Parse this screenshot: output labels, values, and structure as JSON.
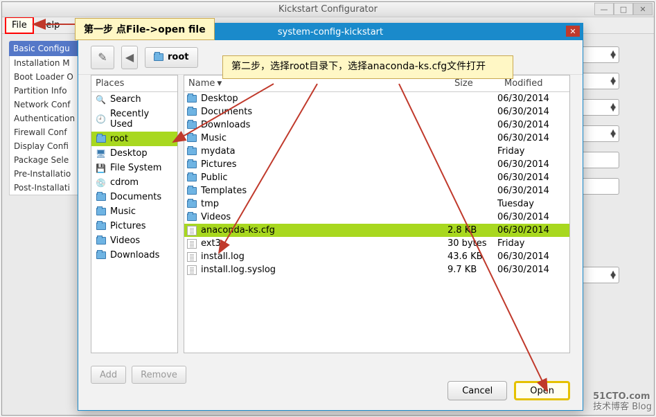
{
  "main": {
    "title": "Kickstart Configurator",
    "menu": {
      "file": "File",
      "help": "Help"
    }
  },
  "mainSidebar": {
    "title": "Basic Configu",
    "items": [
      "Installation M",
      "Boot Loader O",
      "Partition Info",
      "Network Conf",
      "Authentication",
      "Firewall Conf",
      "Display Confi",
      "Package Sele",
      "Pre-Installatio",
      "Post-Installati"
    ]
  },
  "callout1": "第一步 点File->open file",
  "callout2": "第二步，选择root目录下，选择anaconda-ks.cfg文件打开",
  "dialog": {
    "title": "system-config-kickstart",
    "pathbtn": "root",
    "placesHead": "Places",
    "places": [
      {
        "ic": "🔍",
        "label": "Search"
      },
      {
        "ic": "🕘",
        "label": "Recently Used"
      },
      {
        "ic": "📁",
        "label": "root",
        "sel": true
      },
      {
        "ic": "🖥",
        "label": "Desktop"
      },
      {
        "ic": "💾",
        "label": "File System"
      },
      {
        "ic": "💿",
        "label": "cdrom"
      },
      {
        "ic": "📁",
        "label": "Documents"
      },
      {
        "ic": "📁",
        "label": "Music"
      },
      {
        "ic": "📁",
        "label": "Pictures"
      },
      {
        "ic": "📁",
        "label": "Videos"
      },
      {
        "ic": "📁",
        "label": "Downloads"
      }
    ],
    "cols": {
      "name": "Name",
      "size": "Size",
      "modified": "Modified"
    },
    "files": [
      {
        "t": "d",
        "name": "Desktop",
        "size": "",
        "mod": "06/30/2014"
      },
      {
        "t": "d",
        "name": "Documents",
        "size": "",
        "mod": "06/30/2014"
      },
      {
        "t": "d",
        "name": "Downloads",
        "size": "",
        "mod": "06/30/2014"
      },
      {
        "t": "d",
        "name": "Music",
        "size": "",
        "mod": "06/30/2014"
      },
      {
        "t": "d",
        "name": "mydata",
        "size": "",
        "mod": "Friday"
      },
      {
        "t": "d",
        "name": "Pictures",
        "size": "",
        "mod": "06/30/2014"
      },
      {
        "t": "d",
        "name": "Public",
        "size": "",
        "mod": "06/30/2014"
      },
      {
        "t": "d",
        "name": "Templates",
        "size": "",
        "mod": "06/30/2014"
      },
      {
        "t": "d",
        "name": "tmp",
        "size": "",
        "mod": "Tuesday"
      },
      {
        "t": "d",
        "name": "Videos",
        "size": "",
        "mod": "06/30/2014"
      },
      {
        "t": "f",
        "name": "anaconda-ks.cfg",
        "size": "2.8 KB",
        "mod": "06/30/2014",
        "sel": true
      },
      {
        "t": "f",
        "name": "ext3",
        "size": "30 bytes",
        "mod": "Friday"
      },
      {
        "t": "f",
        "name": "install.log",
        "size": "43.6 KB",
        "mod": "06/30/2014"
      },
      {
        "t": "f",
        "name": "install.log.syslog",
        "size": "9.7 KB",
        "mod": "06/30/2014"
      }
    ],
    "add": "Add",
    "remove": "Remove",
    "cancel": "Cancel",
    "open": "Open"
  },
  "watermark": {
    "main": "51CTO.com",
    "sub": "技术博客     Blog"
  }
}
